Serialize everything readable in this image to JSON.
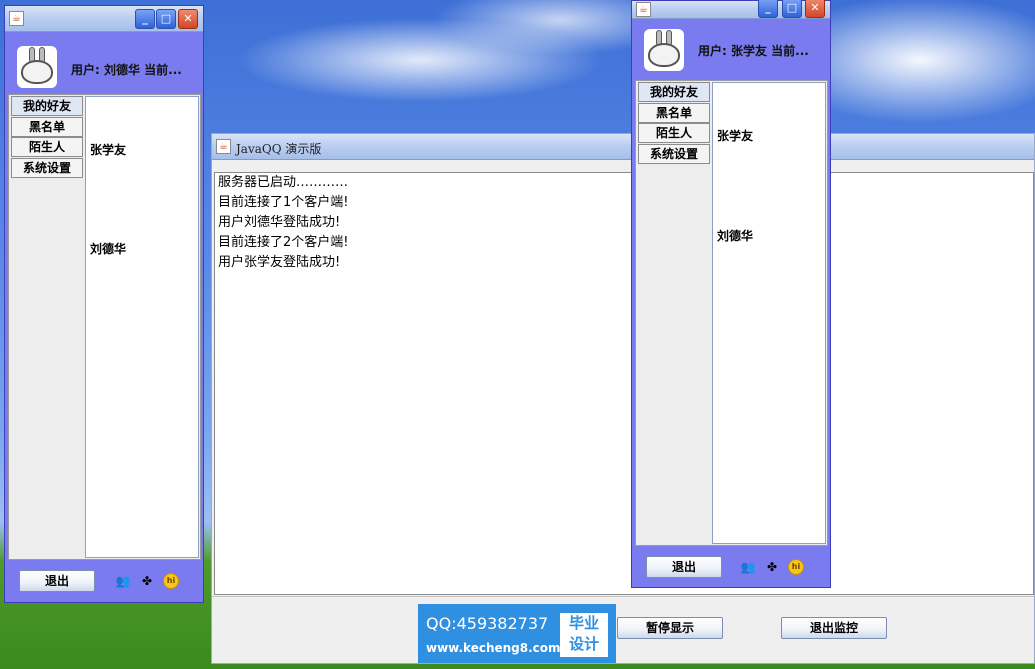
{
  "server": {
    "title": "JavaQQ 演示版",
    "log": [
      "服务器已启动…………",
      "目前连接了1个客户端!",
      "用户刘德华登陆成功!",
      "目前连接了2个客户端!",
      "用户张学友登陆成功!"
    ],
    "pause_label": "暂停显示",
    "exit_monitor_label": "退出监控"
  },
  "client_left": {
    "user_label": "用户: 刘德华 当前...",
    "tabs": [
      "我的好友",
      "黑名单",
      "陌生人",
      "系统设置"
    ],
    "friends": [
      "张学友",
      "刘德华"
    ],
    "exit_label": "退出"
  },
  "client_right": {
    "user_label": "用户: 张学友 当前...",
    "tabs": [
      "我的好友",
      "黑名单",
      "陌生人",
      "系统设置"
    ],
    "friends": [
      "张学友",
      "刘德华"
    ],
    "exit_label": "退出"
  },
  "title_buttons": {
    "minimize": "_",
    "maximize": "□",
    "close": "✕"
  },
  "watermark": {
    "qq": "QQ:459382737",
    "url": "www.kecheng8.com",
    "badge_line1": "毕业",
    "badge_line2": "设计"
  },
  "icons": [
    "java-icon",
    "users-icon",
    "puzzle-icon",
    "hi-icon"
  ],
  "colors": {
    "window_body": "#7b7bf0",
    "titlebar": "#b9cdf0",
    "close_button": "#d2472a"
  }
}
